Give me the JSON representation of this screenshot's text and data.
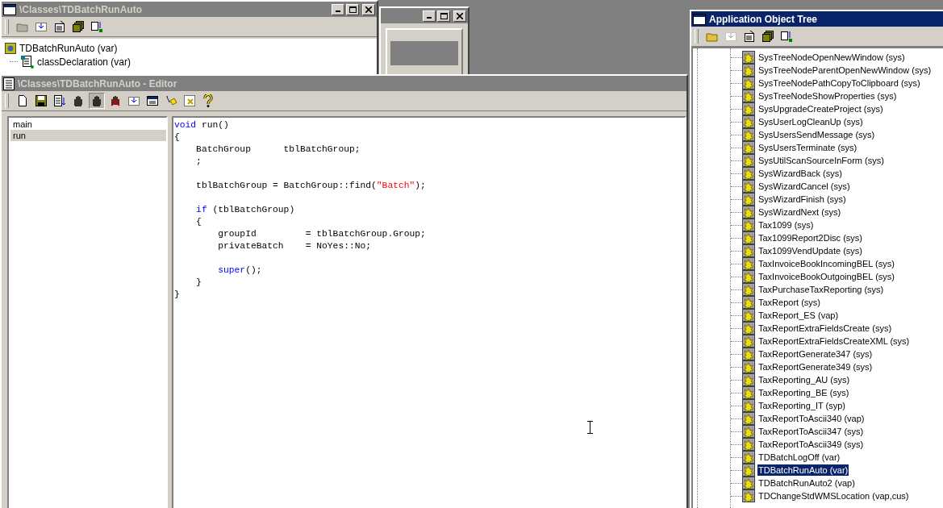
{
  "classes_window": {
    "title": "\\Classes\\TDBatchRunAuto",
    "tree": [
      {
        "label": "TDBatchRunAuto (var)",
        "children": [
          {
            "label": "classDeclaration (var)"
          }
        ]
      }
    ]
  },
  "editor": {
    "title": "\\Classes\\TDBatchRunAuto - Editor",
    "methods": [
      {
        "label": "main",
        "selected": false
      },
      {
        "label": "run",
        "selected": true
      }
    ],
    "code": [
      {
        "kind": "code",
        "segments": [
          {
            "text": "void",
            "kind": "keyword"
          },
          {
            "text": " run()",
            "kind": "plain"
          }
        ]
      },
      {
        "kind": "code",
        "segments": [
          {
            "text": "{",
            "kind": "plain"
          }
        ]
      },
      {
        "kind": "code",
        "segments": [
          {
            "text": "    BatchGroup      tblBatchGroup;",
            "kind": "plain"
          }
        ]
      },
      {
        "kind": "code",
        "segments": [
          {
            "text": "    ;",
            "kind": "plain"
          }
        ]
      },
      {
        "kind": "blank"
      },
      {
        "kind": "code",
        "segments": [
          {
            "text": "    tblBatchGroup = BatchGroup::find(",
            "kind": "plain"
          },
          {
            "text": "\"Batch\"",
            "kind": "string"
          },
          {
            "text": ");",
            "kind": "plain"
          }
        ]
      },
      {
        "kind": "blank"
      },
      {
        "kind": "code",
        "segments": [
          {
            "text": "    if",
            "kind": "keyword"
          },
          {
            "text": " (tblBatchGroup)",
            "kind": "plain"
          }
        ]
      },
      {
        "kind": "code",
        "segments": [
          {
            "text": "    {",
            "kind": "plain"
          }
        ]
      },
      {
        "kind": "code",
        "segments": [
          {
            "text": "        groupId         = tblBatchGroup.Group;",
            "kind": "plain"
          }
        ]
      },
      {
        "kind": "code",
        "segments": [
          {
            "text": "        privateBatch    = NoYes::No;",
            "kind": "plain"
          }
        ]
      },
      {
        "kind": "blank"
      },
      {
        "kind": "code",
        "segments": [
          {
            "text": "        super",
            "kind": "keyword"
          },
          {
            "text": "();",
            "kind": "plain"
          }
        ]
      },
      {
        "kind": "code",
        "segments": [
          {
            "text": "    }",
            "kind": "plain"
          }
        ]
      },
      {
        "kind": "code",
        "segments": [
          {
            "text": "}",
            "kind": "plain"
          }
        ]
      }
    ]
  },
  "aot": {
    "title": "Application Object Tree",
    "items": [
      {
        "label": "SysTreeNodeOpenNewWindow (sys)",
        "selected": false
      },
      {
        "label": "SysTreeNodeParentOpenNewWindow (sys)",
        "selected": false
      },
      {
        "label": "SysTreeNodePathCopyToClipboard (sys)",
        "selected": false
      },
      {
        "label": "SysTreeNodeShowProperties (sys)",
        "selected": false
      },
      {
        "label": "SysUpgradeCreateProject (sys)",
        "selected": false
      },
      {
        "label": "SysUserLogCleanUp (sys)",
        "selected": false
      },
      {
        "label": "SysUsersSendMessage (sys)",
        "selected": false
      },
      {
        "label": "SysUsersTerminate (sys)",
        "selected": false
      },
      {
        "label": "SysUtilScanSourceInForm (sys)",
        "selected": false
      },
      {
        "label": "SysWizardBack (sys)",
        "selected": false
      },
      {
        "label": "SysWizardCancel (sys)",
        "selected": false
      },
      {
        "label": "SysWizardFinish (sys)",
        "selected": false
      },
      {
        "label": "SysWizardNext (sys)",
        "selected": false
      },
      {
        "label": "Tax1099 (sys)",
        "selected": false
      },
      {
        "label": "Tax1099Report2Disc (sys)",
        "selected": false
      },
      {
        "label": "Tax1099VendUpdate (sys)",
        "selected": false
      },
      {
        "label": "TaxInvoiceBookIncomingBEL (sys)",
        "selected": false
      },
      {
        "label": "TaxInvoiceBookOutgoingBEL (sys)",
        "selected": false
      },
      {
        "label": "TaxPurchaseTaxReporting (sys)",
        "selected": false
      },
      {
        "label": "TaxReport (sys)",
        "selected": false
      },
      {
        "label": "TaxReport_ES (vap)",
        "selected": false
      },
      {
        "label": "TaxReportExtraFieldsCreate (sys)",
        "selected": false
      },
      {
        "label": "TaxReportExtraFieldsCreateXML (sys)",
        "selected": false
      },
      {
        "label": "TaxReportGenerate347 (sys)",
        "selected": false
      },
      {
        "label": "TaxReportGenerate349 (sys)",
        "selected": false
      },
      {
        "label": "TaxReporting_AU (sys)",
        "selected": false
      },
      {
        "label": "TaxReporting_BE (sys)",
        "selected": false
      },
      {
        "label": "TaxReporting_IT (syp)",
        "selected": false
      },
      {
        "label": "TaxReportToAscii340 (vap)",
        "selected": false
      },
      {
        "label": "TaxReportToAscii347 (sys)",
        "selected": false
      },
      {
        "label": "TaxReportToAscii349 (sys)",
        "selected": false
      },
      {
        "label": "TDBatchLogOff (var)",
        "selected": false
      },
      {
        "label": "TDBatchRunAuto (var)",
        "selected": true
      },
      {
        "label": "TDBatchRunAuto2 (vap)",
        "selected": false
      },
      {
        "label": "TDChangeStdWMSLocation (vap,cus)",
        "selected": false
      }
    ]
  }
}
